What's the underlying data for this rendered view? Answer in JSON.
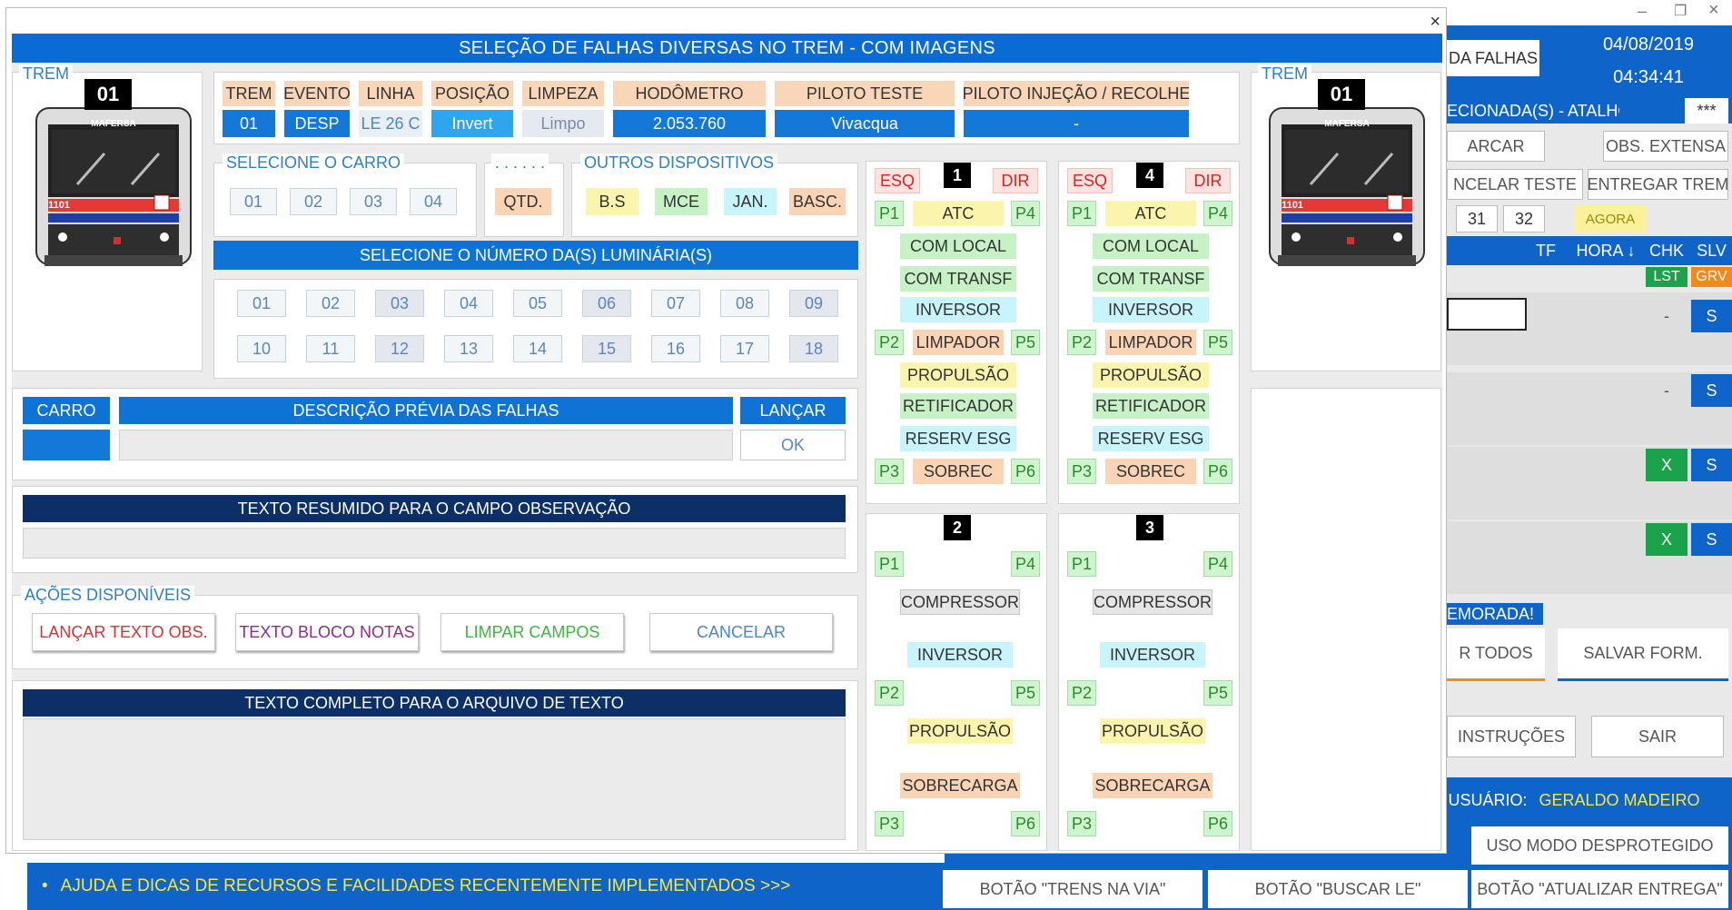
{
  "dialog": {
    "title": "SELEÇÃO DE FALHAS DIVERSAS NO TREM - COM IMAGENS",
    "close": "×"
  },
  "left_train": {
    "legend": "TREM",
    "number": "01",
    "brand": "MAFERSA",
    "code": "1101"
  },
  "right_train": {
    "legend": "TREM",
    "number": "01",
    "brand": "MAFERSA",
    "code": "1101"
  },
  "info": {
    "headers": [
      "TREM",
      "EVENTO",
      "LINHA",
      "POSIÇÃO",
      "LIMPEZA",
      "HODÔMETRO",
      "PILOTO TESTE",
      "PILOTO INJEÇÃO / RECOLHE"
    ],
    "values": [
      "01",
      "DESP",
      "LE 26 C",
      "Invert",
      "Limpo",
      "2.053.760",
      "Vivacqua",
      "-"
    ]
  },
  "carro": {
    "legend": "SELECIONE O CARRO",
    "buttons": [
      "01",
      "02",
      "03",
      "04"
    ]
  },
  "qtd": {
    "legend": ". . . . . .",
    "button": "QTD."
  },
  "outros": {
    "legend": "OUTROS DISPOSITIVOS",
    "buttons": [
      "B.S",
      "MCE",
      "JAN.",
      "BASC."
    ]
  },
  "luminarias": {
    "title": "SELECIONE O NÚMERO DA(S) LUMINÁRIA(S)",
    "row1": [
      "01",
      "02",
      "03",
      "04",
      "05",
      "06",
      "07",
      "08",
      "09"
    ],
    "row2": [
      "10",
      "11",
      "12",
      "13",
      "14",
      "15",
      "16",
      "17",
      "18"
    ]
  },
  "desc": {
    "carro": "CARRO",
    "descricao": "DESCRIÇÃO PRÉVIA DAS FALHAS",
    "lancar": "LANÇAR",
    "ok": "OK"
  },
  "resumido": {
    "title": "TEXTO RESUMIDO PARA O CAMPO OBSERVAÇÃO"
  },
  "acoes": {
    "legend": "AÇÕES DISPONÍVEIS",
    "buttons": [
      "LANÇAR TEXTO OBS.",
      "TEXTO BLOCO NOTAS",
      "LIMPAR CAMPOS",
      "CANCELAR"
    ]
  },
  "completo": {
    "title": "TEXTO COMPLETO PARA O ARQUIVO DE TEXTO"
  },
  "car1": {
    "num": "1",
    "esq": "ESQ",
    "dir": "DIR",
    "p": [
      "P1",
      "P4",
      "P2",
      "P5",
      "P3",
      "P6"
    ],
    "items": [
      "ATC",
      "COM LOCAL",
      "COM TRANSF",
      "INVERSOR",
      "LIMPADOR",
      "PROPULSÃO",
      "RETIFICADOR",
      "RESERV ESG",
      "SOBREC"
    ]
  },
  "car4": {
    "num": "4",
    "esq": "ESQ",
    "dir": "DIR",
    "p": [
      "P1",
      "P4",
      "P2",
      "P5",
      "P3",
      "P6"
    ],
    "items": [
      "ATC",
      "COM LOCAL",
      "COM TRANSF",
      "INVERSOR",
      "LIMPADOR",
      "PROPULSÃO",
      "RETIFICADOR",
      "RESERV ESG",
      "SOBREC"
    ]
  },
  "car2": {
    "num": "2",
    "p": [
      "P1",
      "P4",
      "P2",
      "P5",
      "P3",
      "P6"
    ],
    "items": [
      "COMPRESSOR",
      "INVERSOR",
      "PROPULSÃO",
      "SOBRECARGA"
    ]
  },
  "car3": {
    "num": "3",
    "p": [
      "P1",
      "P4",
      "P2",
      "P5",
      "P3",
      "P6"
    ],
    "items": [
      "COMPRESSOR",
      "INVERSOR",
      "PROPULSÃO",
      "SOBRECARGA"
    ]
  },
  "background": {
    "falhas": "DA FALHAS",
    "date": "04/08/2019",
    "time": "04:34:41",
    "atalhos": "ECIONADA(S) - ATALHOS >>>",
    "stars": "***",
    "marcar": "ARCAR",
    "obs": "OBS. EXTENSA",
    "cancelar": "NCELAR TESTE",
    "entregar": "ENTREGAR TREM",
    "n31": "31",
    "n32": "32",
    "agora": "AGORA",
    "col_tf": "TF",
    "col_hora": "HORA ↓",
    "col_chk": "CHK",
    "col_slv": "SLV",
    "lst": "LST",
    "grv": "GRV",
    "dash": "-",
    "s": "S",
    "x": "X",
    "demorada": "EMORADA!",
    "todos": "R TODOS",
    "salvar": "SALVAR FORM.",
    "instrucoes": "INSTRUÇÕES",
    "sair": "SAIR",
    "usuario_label": "USUÁRIO:",
    "usuario": "GERALDO MADEIRO",
    "desprotegido": "USO MODO DESPROTEGIDO",
    "ajuda": "AJUDA E DICAS DE RECURSOS E FACILIDADES RECENTEMENTE IMPLEMENTADOS   >>>",
    "b1": "BOTÃO \"TRENS NA VIA\"",
    "b2": "BOTÃO \"BUSCAR LE\"",
    "b3": "BOTÃO \"ATUALIZAR ENTREGA\"",
    "minimize": "–",
    "restore": "❐",
    "close": "×"
  }
}
